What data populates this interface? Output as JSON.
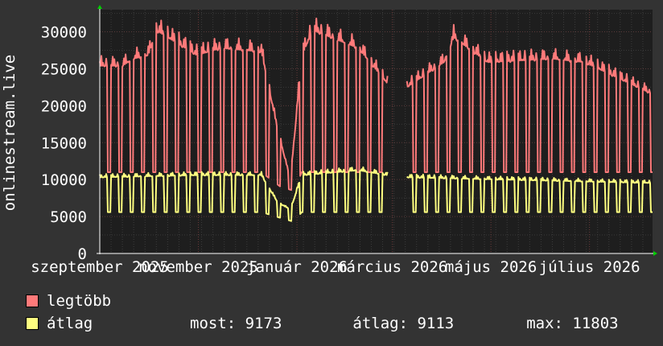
{
  "chart_data": {
    "type": "line",
    "ylabel": "onlinestream.live",
    "ylim": [
      0,
      33000
    ],
    "yticks": [
      0,
      5000,
      10000,
      15000,
      20000,
      25000,
      30000
    ],
    "ytick_labels": [
      "0",
      "5000",
      "10000",
      "15000",
      "20000",
      "25000",
      "30000"
    ],
    "x_range_days": [
      0,
      342
    ],
    "xtick_labels": [
      {
        "day": 0,
        "label": "szeptember 2025"
      },
      {
        "day": 61,
        "label": "november 2025"
      },
      {
        "day": 122,
        "label": "január 2026"
      },
      {
        "day": 181,
        "label": "március 2026"
      },
      {
        "day": 242,
        "label": "május 2026"
      },
      {
        "day": 303,
        "label": "július 2026"
      }
    ],
    "grid": true,
    "gaps": [
      [
        178,
        190
      ]
    ],
    "series": [
      {
        "name": "legtöbb",
        "color": "#ff7a7a",
        "weekday_max_profile": [
          [
            0,
            26000
          ],
          [
            14,
            26000
          ],
          [
            21,
            27000
          ],
          [
            30,
            27500
          ],
          [
            35,
            31000
          ],
          [
            60,
            27500
          ],
          [
            75,
            28500
          ],
          [
            100,
            28000
          ],
          [
            110,
            17000
          ],
          [
            118,
            10000
          ],
          [
            125,
            27500
          ],
          [
            132,
            31000
          ],
          [
            160,
            28500
          ],
          [
            178,
            23500
          ],
          [
            190,
            23000
          ],
          [
            213,
            26500
          ],
          [
            219,
            30000
          ],
          [
            240,
            26500
          ],
          [
            280,
            27000
          ],
          [
            300,
            26500
          ],
          [
            342,
            22000
          ]
        ],
        "weekend_min_profile": [
          [
            0,
            11000
          ],
          [
            100,
            11000
          ],
          [
            112,
            9000
          ],
          [
            120,
            8500
          ],
          [
            125,
            11000
          ],
          [
            342,
            11000
          ]
        ]
      },
      {
        "name": "átlag",
        "color": "#ffff80",
        "weekday_max_profile": [
          [
            0,
            10500
          ],
          [
            60,
            10800
          ],
          [
            100,
            10800
          ],
          [
            110,
            7000
          ],
          [
            118,
            6000
          ],
          [
            125,
            10800
          ],
          [
            160,
            11500
          ],
          [
            178,
            10800
          ],
          [
            190,
            10500
          ],
          [
            342,
            9700
          ]
        ],
        "weekend_min_profile": [
          [
            0,
            5600
          ],
          [
            100,
            5600
          ],
          [
            112,
            4800
          ],
          [
            120,
            4300
          ],
          [
            125,
            5600
          ],
          [
            342,
            5600
          ]
        ]
      }
    ]
  },
  "legend": [
    {
      "label": "legtöbb",
      "color": "#ff7a7a"
    },
    {
      "label": "átlag",
      "color": "#ffff80"
    }
  ],
  "stats": {
    "most": "most: 9173",
    "atlag": "átlag: 9113",
    "max": "max: 11803"
  }
}
